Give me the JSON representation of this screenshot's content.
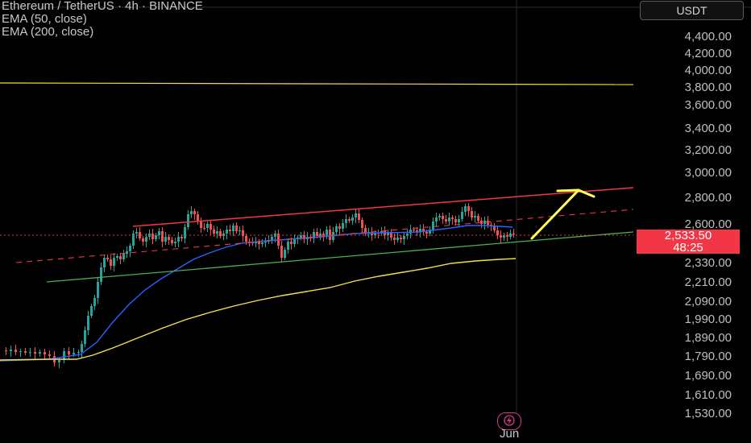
{
  "legend": {
    "title": "Ethereum / TetherUS · 4h · BINANCE",
    "ema50": "EMA (50, close)",
    "ema200": "EMA (200, close)"
  },
  "currency_button": "USDT",
  "price_axis": {
    "ticks": [
      "4,400.00",
      "4,200.00",
      "4,000.00",
      "3,800.00",
      "3,600.00",
      "3,400.00",
      "3,200.00",
      "3,000.00",
      "2,800.00",
      "2,600.00",
      "2,330.00",
      "2,210.00",
      "2,090.00",
      "1,990.00",
      "1,890.00",
      "1,790.00",
      "1,690.00",
      "1,610.00",
      "1,530.00"
    ]
  },
  "last_price": {
    "value": "2,533.50",
    "countdown": "48:25"
  },
  "time_axis": {
    "month_label": "Jun"
  },
  "colors": {
    "background": "#000000",
    "up": "#26a69a",
    "down": "#ef5350",
    "ema50": "#2962ff",
    "ema200": "#f2e04a",
    "upper_channel": "#f23645",
    "lower_channel": "#4caf50",
    "resistance": "#f2e04a",
    "arrow": "#ffff55",
    "price_tag": "#f23645"
  },
  "icons": {
    "bolt": "lightning-bolt-icon"
  },
  "chart_data": {
    "type": "candlestick",
    "symbol": "Ethereum / TetherUS",
    "interval": "4h",
    "exchange": "BINANCE",
    "last_price": 2533.5,
    "horizontal_line": 3850,
    "ema200_end": 2390,
    "note_overlays": [
      "rising channel",
      "projection arrow"
    ]
  }
}
